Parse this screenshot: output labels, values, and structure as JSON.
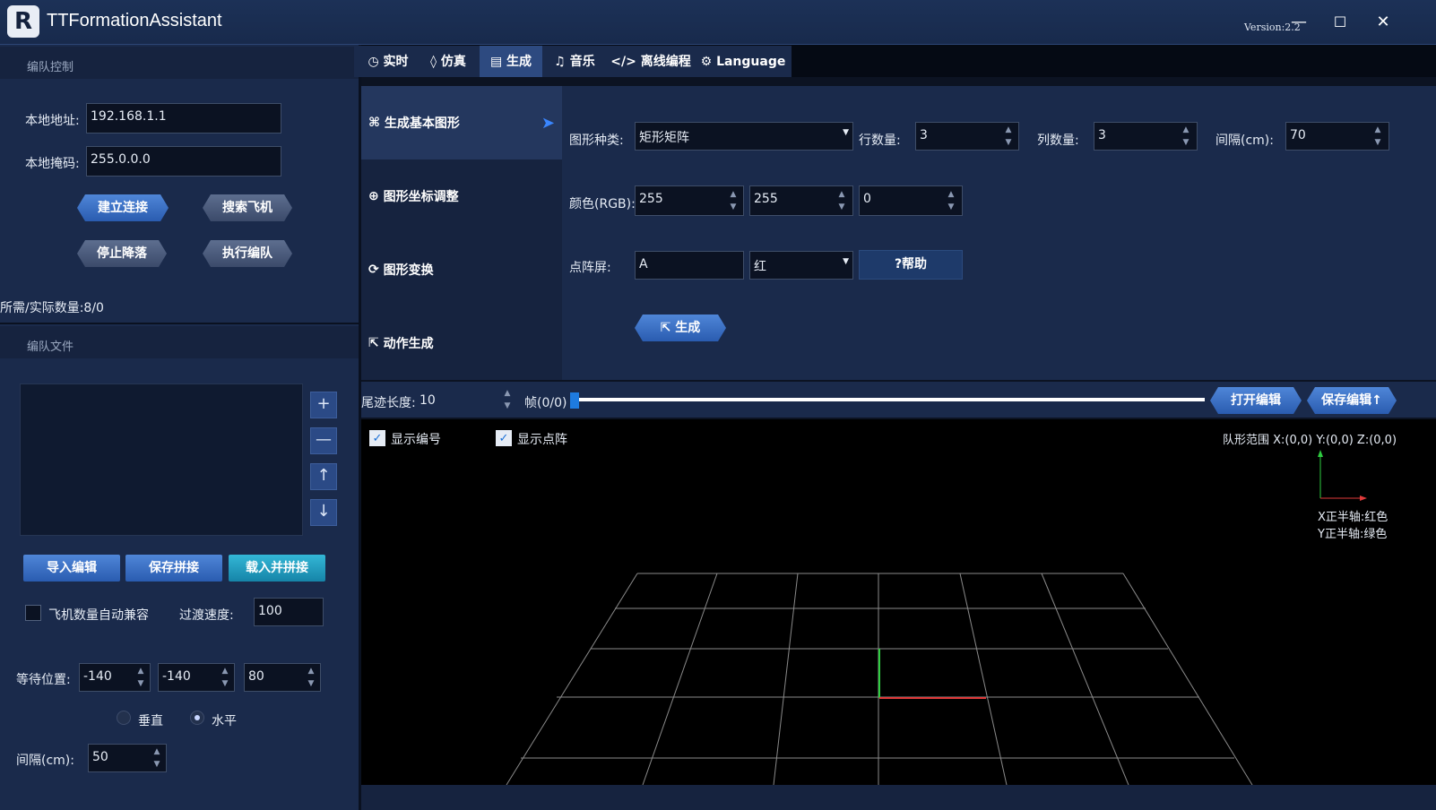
{
  "app": {
    "title": "TTFormationAssistant",
    "version": "Version:2.2",
    "logo_text": "R"
  },
  "window_controls": {
    "minimize": "—",
    "maximize": "☐",
    "close": "✕"
  },
  "left_panel": {
    "formation_control": {
      "header": "编队控制",
      "local_address_label": "本地地址:",
      "local_address_value": "192.168.1.1",
      "local_mask_label": "本地掩码:",
      "local_mask_value": "255.0.0.0",
      "connect_button": "建立连接",
      "search_button": "搜索飞机",
      "stop_land_button": "停止降落",
      "execute_button": "执行编队",
      "count_text": "所需/实际数量:8/0"
    },
    "formation_file": {
      "header": "编队文件",
      "side_buttons": [
        "+",
        "—",
        "↑",
        "↓"
      ],
      "import_button": "导入编辑",
      "save_splice_button": "保存拼接",
      "load_splice_button": "载入并拼接",
      "auto_compat_label": "飞机数量自动兼容",
      "transition_speed_label": "过渡速度:",
      "transition_speed_value": "100",
      "wait_position_label": "等待位置:",
      "wait_position_values": [
        "-140",
        "-140",
        "80"
      ],
      "vertical_label": "垂直",
      "horizontal_label": "水平",
      "spacing_label": "间隔(cm):",
      "spacing_value": "50"
    }
  },
  "tabs": [
    {
      "icon": "◷",
      "label": "实时"
    },
    {
      "icon": "◊",
      "label": "仿真"
    },
    {
      "icon": "▤",
      "label": "生成"
    },
    {
      "icon": "♫",
      "label": "音乐"
    },
    {
      "icon": "</>",
      "label": "离线编程"
    },
    {
      "icon": "⚙",
      "label": "Language"
    }
  ],
  "active_tab": "生成",
  "subnav": [
    {
      "icon": "⌘",
      "label": "生成基本图形"
    },
    {
      "icon": "⊕",
      "label": "图形坐标调整"
    },
    {
      "icon": "⟳",
      "label": "图形变换"
    },
    {
      "icon": "⇱",
      "label": "动作生成"
    }
  ],
  "generate_form": {
    "shape_type_label": "图形种类:",
    "shape_type_value": "矩形矩阵",
    "rows_label": "行数量:",
    "rows_value": "3",
    "cols_label": "列数量:",
    "cols_value": "3",
    "interval_label": "间隔(cm):",
    "interval_value": "70",
    "color_label": "颜色(RGB):",
    "color_r": "255",
    "color_g": "255",
    "color_b": "0",
    "dot_matrix_label": "点阵屏:",
    "dot_matrix_value": "A",
    "dot_color_value": "红",
    "help_button": "?帮助",
    "generate_button": "生成"
  },
  "timeline": {
    "trail_length_label": "尾迹长度:",
    "trail_length_value": "10",
    "frame_label": "帧(0/0)",
    "open_edit_button": "打开编辑",
    "save_edit_button": "保存编辑↑",
    "progress": 0
  },
  "viewport": {
    "show_ids_label": "显示编号",
    "show_matrix_label": "显示点阵",
    "range_text": "队形范围 X:(0,0) Y:(0,0) Z:(0,0)",
    "x_axis_legend": "X正半轴:红色",
    "y_axis_legend": "Y正半轴:绿色"
  },
  "colors": {
    "accent": "#2d5fb3",
    "panel": "#1a2a4b",
    "x_axis": "#e03a3a",
    "y_axis": "#2ecc40"
  }
}
